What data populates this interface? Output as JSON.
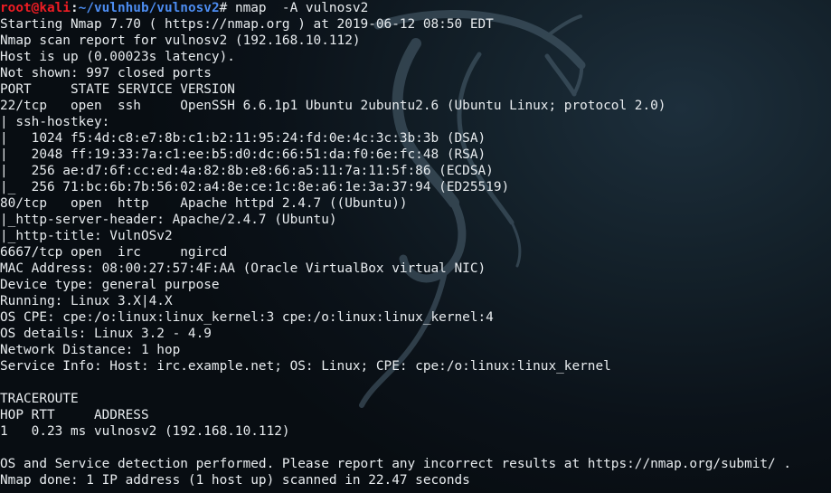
{
  "prompt": {
    "user": "root@kali",
    "colon": ":",
    "path": "~/vulnhub/vulnosv2",
    "symbol": "#",
    "command": " nmap  -A vulnosv2"
  },
  "output_lines": [
    "Starting Nmap 7.70 ( https://nmap.org ) at 2019-06-12 08:50 EDT",
    "Nmap scan report for vulnosv2 (192.168.10.112)",
    "Host is up (0.00023s latency).",
    "Not shown: 997 closed ports",
    "PORT     STATE SERVICE VERSION",
    "22/tcp   open  ssh     OpenSSH 6.6.1p1 Ubuntu 2ubuntu2.6 (Ubuntu Linux; protocol 2.0)",
    "| ssh-hostkey: ",
    "|   1024 f5:4d:c8:e7:8b:c1:b2:11:95:24:fd:0e:4c:3c:3b:3b (DSA)",
    "|   2048 ff:19:33:7a:c1:ee:b5:d0:dc:66:51:da:f0:6e:fc:48 (RSA)",
    "|   256 ae:d7:6f:cc:ed:4a:82:8b:e8:66:a5:11:7a:11:5f:86 (ECDSA)",
    "|_  256 71:bc:6b:7b:56:02:a4:8e:ce:1c:8e:a6:1e:3a:37:94 (ED25519)",
    "80/tcp   open  http    Apache httpd 2.4.7 ((Ubuntu))",
    "|_http-server-header: Apache/2.4.7 (Ubuntu)",
    "|_http-title: VulnOSv2",
    "6667/tcp open  irc     ngircd",
    "MAC Address: 08:00:27:57:4F:AA (Oracle VirtualBox virtual NIC)",
    "Device type: general purpose",
    "Running: Linux 3.X|4.X",
    "OS CPE: cpe:/o:linux:linux_kernel:3 cpe:/o:linux:linux_kernel:4",
    "OS details: Linux 3.2 - 4.9",
    "Network Distance: 1 hop",
    "Service Info: Host: irc.example.net; OS: Linux; CPE: cpe:/o:linux:linux_kernel",
    "",
    "TRACEROUTE",
    "HOP RTT     ADDRESS",
    "1   0.23 ms vulnosv2 (192.168.10.112)",
    "",
    "OS and Service detection performed. Please report any incorrect results at https://nmap.org/submit/ .",
    "Nmap done: 1 IP address (1 host up) scanned in 22.47 seconds"
  ],
  "colors": {
    "user": "#ee1c23",
    "path": "#4c8cf0",
    "text": "#e8ecef",
    "background": "#0b1219"
  },
  "icons": {
    "background_logo": "kali-dragon-icon"
  }
}
